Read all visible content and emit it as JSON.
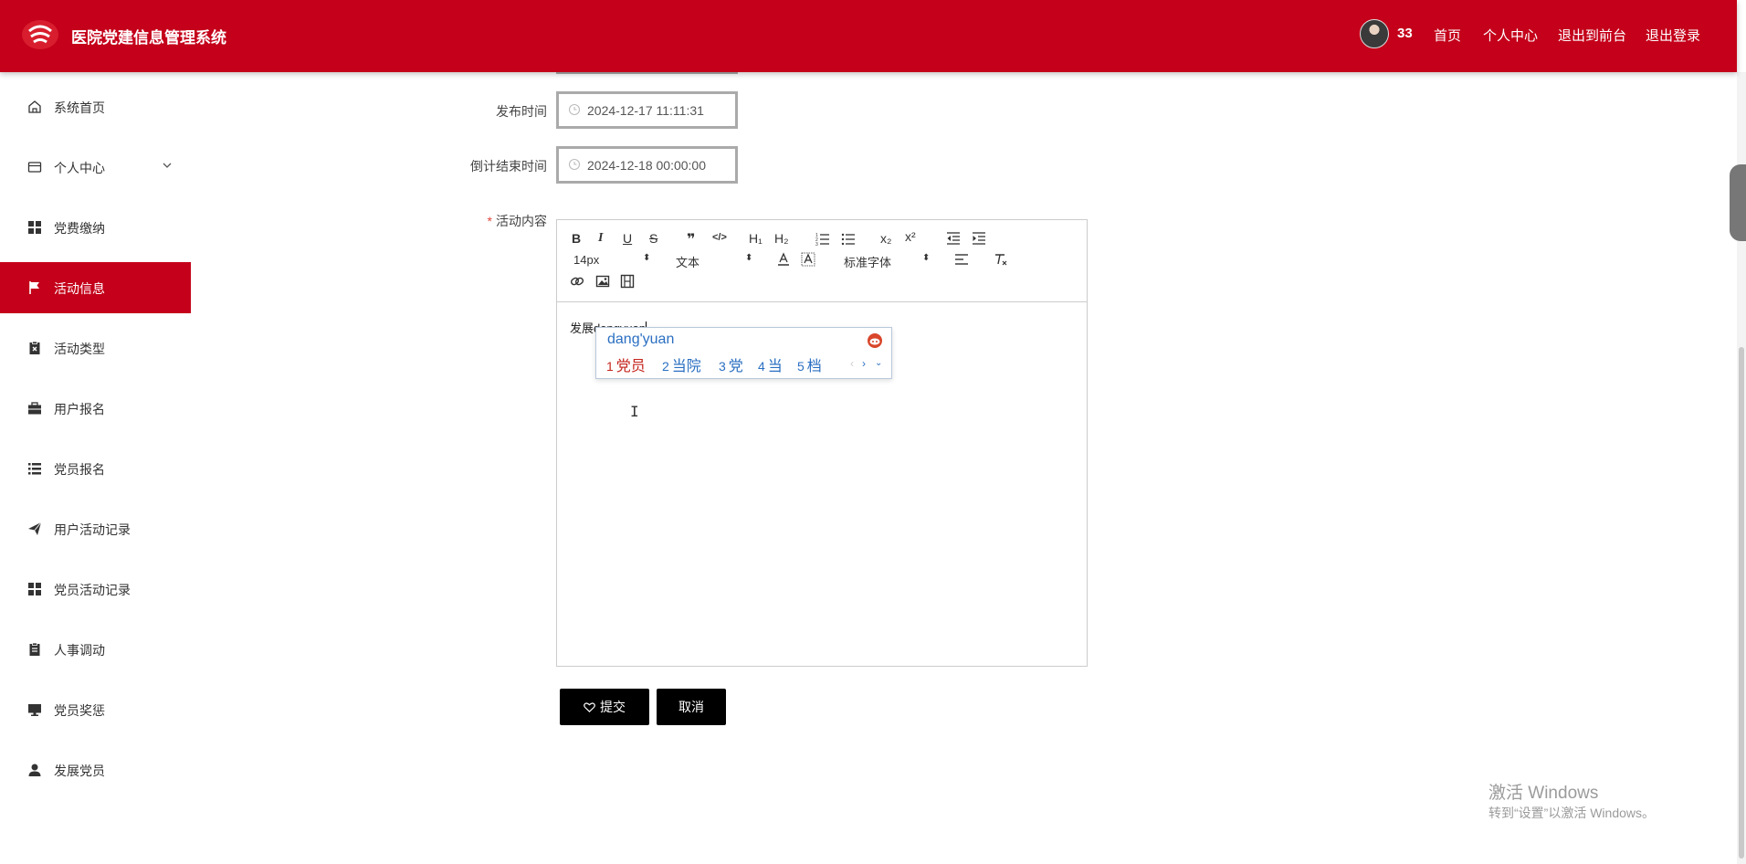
{
  "header": {
    "app_title": "医院党建信息管理系统",
    "user_name": "33",
    "nav": [
      "首页",
      "个人中心",
      "退出到前台",
      "退出登录"
    ],
    "brand_color": "#c4001a"
  },
  "sidebar": {
    "items": [
      {
        "label": "系统首页",
        "icon": "home-icon"
      },
      {
        "label": "个人中心",
        "icon": "card-icon"
      },
      {
        "label": "党费缴纳",
        "icon": "grid-icon"
      },
      {
        "label": "活动信息",
        "icon": "flag-icon"
      },
      {
        "label": "活动类型",
        "icon": "clipboard-x-icon"
      },
      {
        "label": "用户报名",
        "icon": "briefcase-icon"
      },
      {
        "label": "党员报名",
        "icon": "list-icon"
      },
      {
        "label": "用户活动记录",
        "icon": "paper-plane-icon"
      },
      {
        "label": "党员活动记录",
        "icon": "grid-icon"
      },
      {
        "label": "人事调动",
        "icon": "clipboard-icon"
      },
      {
        "label": "党员奖惩",
        "icon": "monitor-icon"
      },
      {
        "label": "发展党员",
        "icon": "user-icon"
      }
    ],
    "active": "活动信息"
  },
  "form": {
    "publish_time_label": "发布时间",
    "publish_time_value": "2024-12-17 11:11:31",
    "countdown_label": "倒计结束时间",
    "countdown_value": "2024-12-18 00:00:00",
    "content_label": "活动内容",
    "required_mark": "*"
  },
  "editor": {
    "toolbar": {
      "bold": "B",
      "italic": "I",
      "underline": "U",
      "strike": "S",
      "quote": "❞",
      "code": "</>",
      "h1": "H₁",
      "h2": "H₂",
      "sub": "x₂",
      "sup": "x²",
      "size": "14px",
      "header": "文本",
      "font": "标准字体"
    },
    "content_text": "发展dangyuan"
  },
  "ime": {
    "pinyin": "dang'yuan",
    "candidates": [
      {
        "n": "1",
        "text": "党员"
      },
      {
        "n": "2",
        "text": "当院"
      },
      {
        "n": "3",
        "text": "党"
      },
      {
        "n": "4",
        "text": "当"
      },
      {
        "n": "5",
        "text": "档"
      }
    ]
  },
  "actions": {
    "submit": "提交",
    "cancel": "取消"
  },
  "watermark": {
    "line1": "激活 Windows",
    "line2": "转到“设置”以激活 Windows。"
  }
}
